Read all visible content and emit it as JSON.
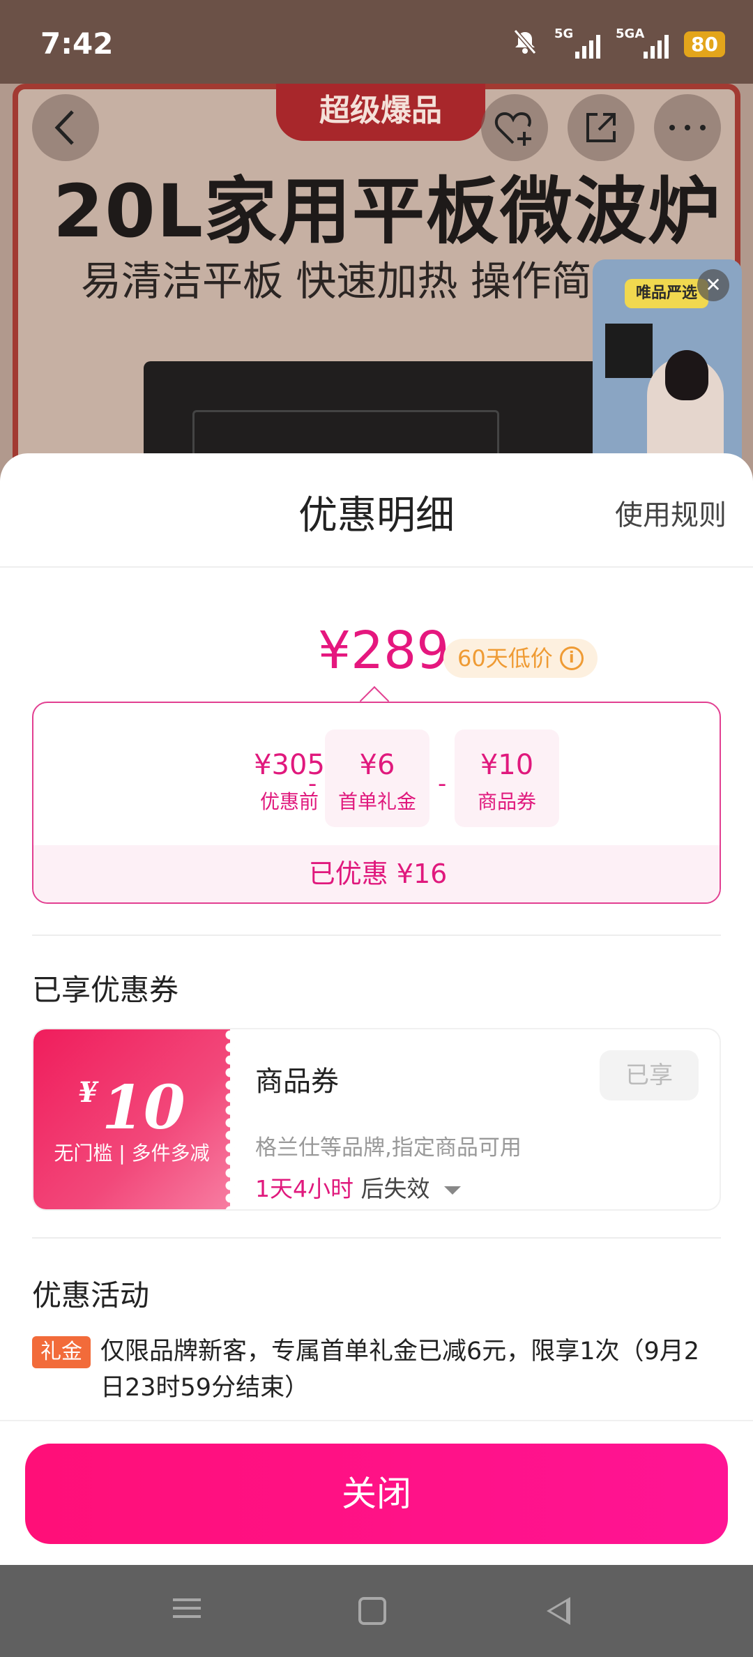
{
  "status_bar": {
    "time": "7:42",
    "signal1_label": "5G",
    "signal2_label": "5GA",
    "battery": "80"
  },
  "background_page": {
    "hero_tag": "超级爆品",
    "hero_title": "20L家用平板微波炉",
    "hero_subtitle": "易清洁平板 快速加热 操作简易",
    "float_badge": "唯品严选"
  },
  "sheet": {
    "title": "优惠明细",
    "rules_link": "使用规则",
    "final_price": "¥289",
    "low_price_badge": "60天低价",
    "breakdown": {
      "items": [
        {
          "amount": "¥305",
          "label": "优惠前"
        },
        {
          "amount": "¥6",
          "label": "首单礼金"
        },
        {
          "amount": "¥10",
          "label": "商品券"
        }
      ],
      "operator": "-",
      "total_saved": "已优惠 ¥16"
    },
    "coupons_section": {
      "title": "已享优惠券",
      "coupon": {
        "currency": "¥",
        "value": "10",
        "condition": "无门槛 | 多件多减",
        "name": "商品券",
        "status": "已享",
        "description": "格兰仕等品牌,指定商品可用",
        "expire_highlight": "1天4小时",
        "expire_suffix": "后失效"
      }
    },
    "promotions_section": {
      "title": "优惠活动",
      "items": [
        {
          "tag": "礼金",
          "text": "仅限品牌新客，专属首单礼金已减6元，限享1次（9月2日23时59分结束）"
        }
      ]
    },
    "close_button": "关闭"
  },
  "colors": {
    "accent_pink": "#e0197d",
    "button_pink": "#ff0f78",
    "badge_orange": "#ef9b34",
    "promo_tag": "#f26b3a"
  }
}
